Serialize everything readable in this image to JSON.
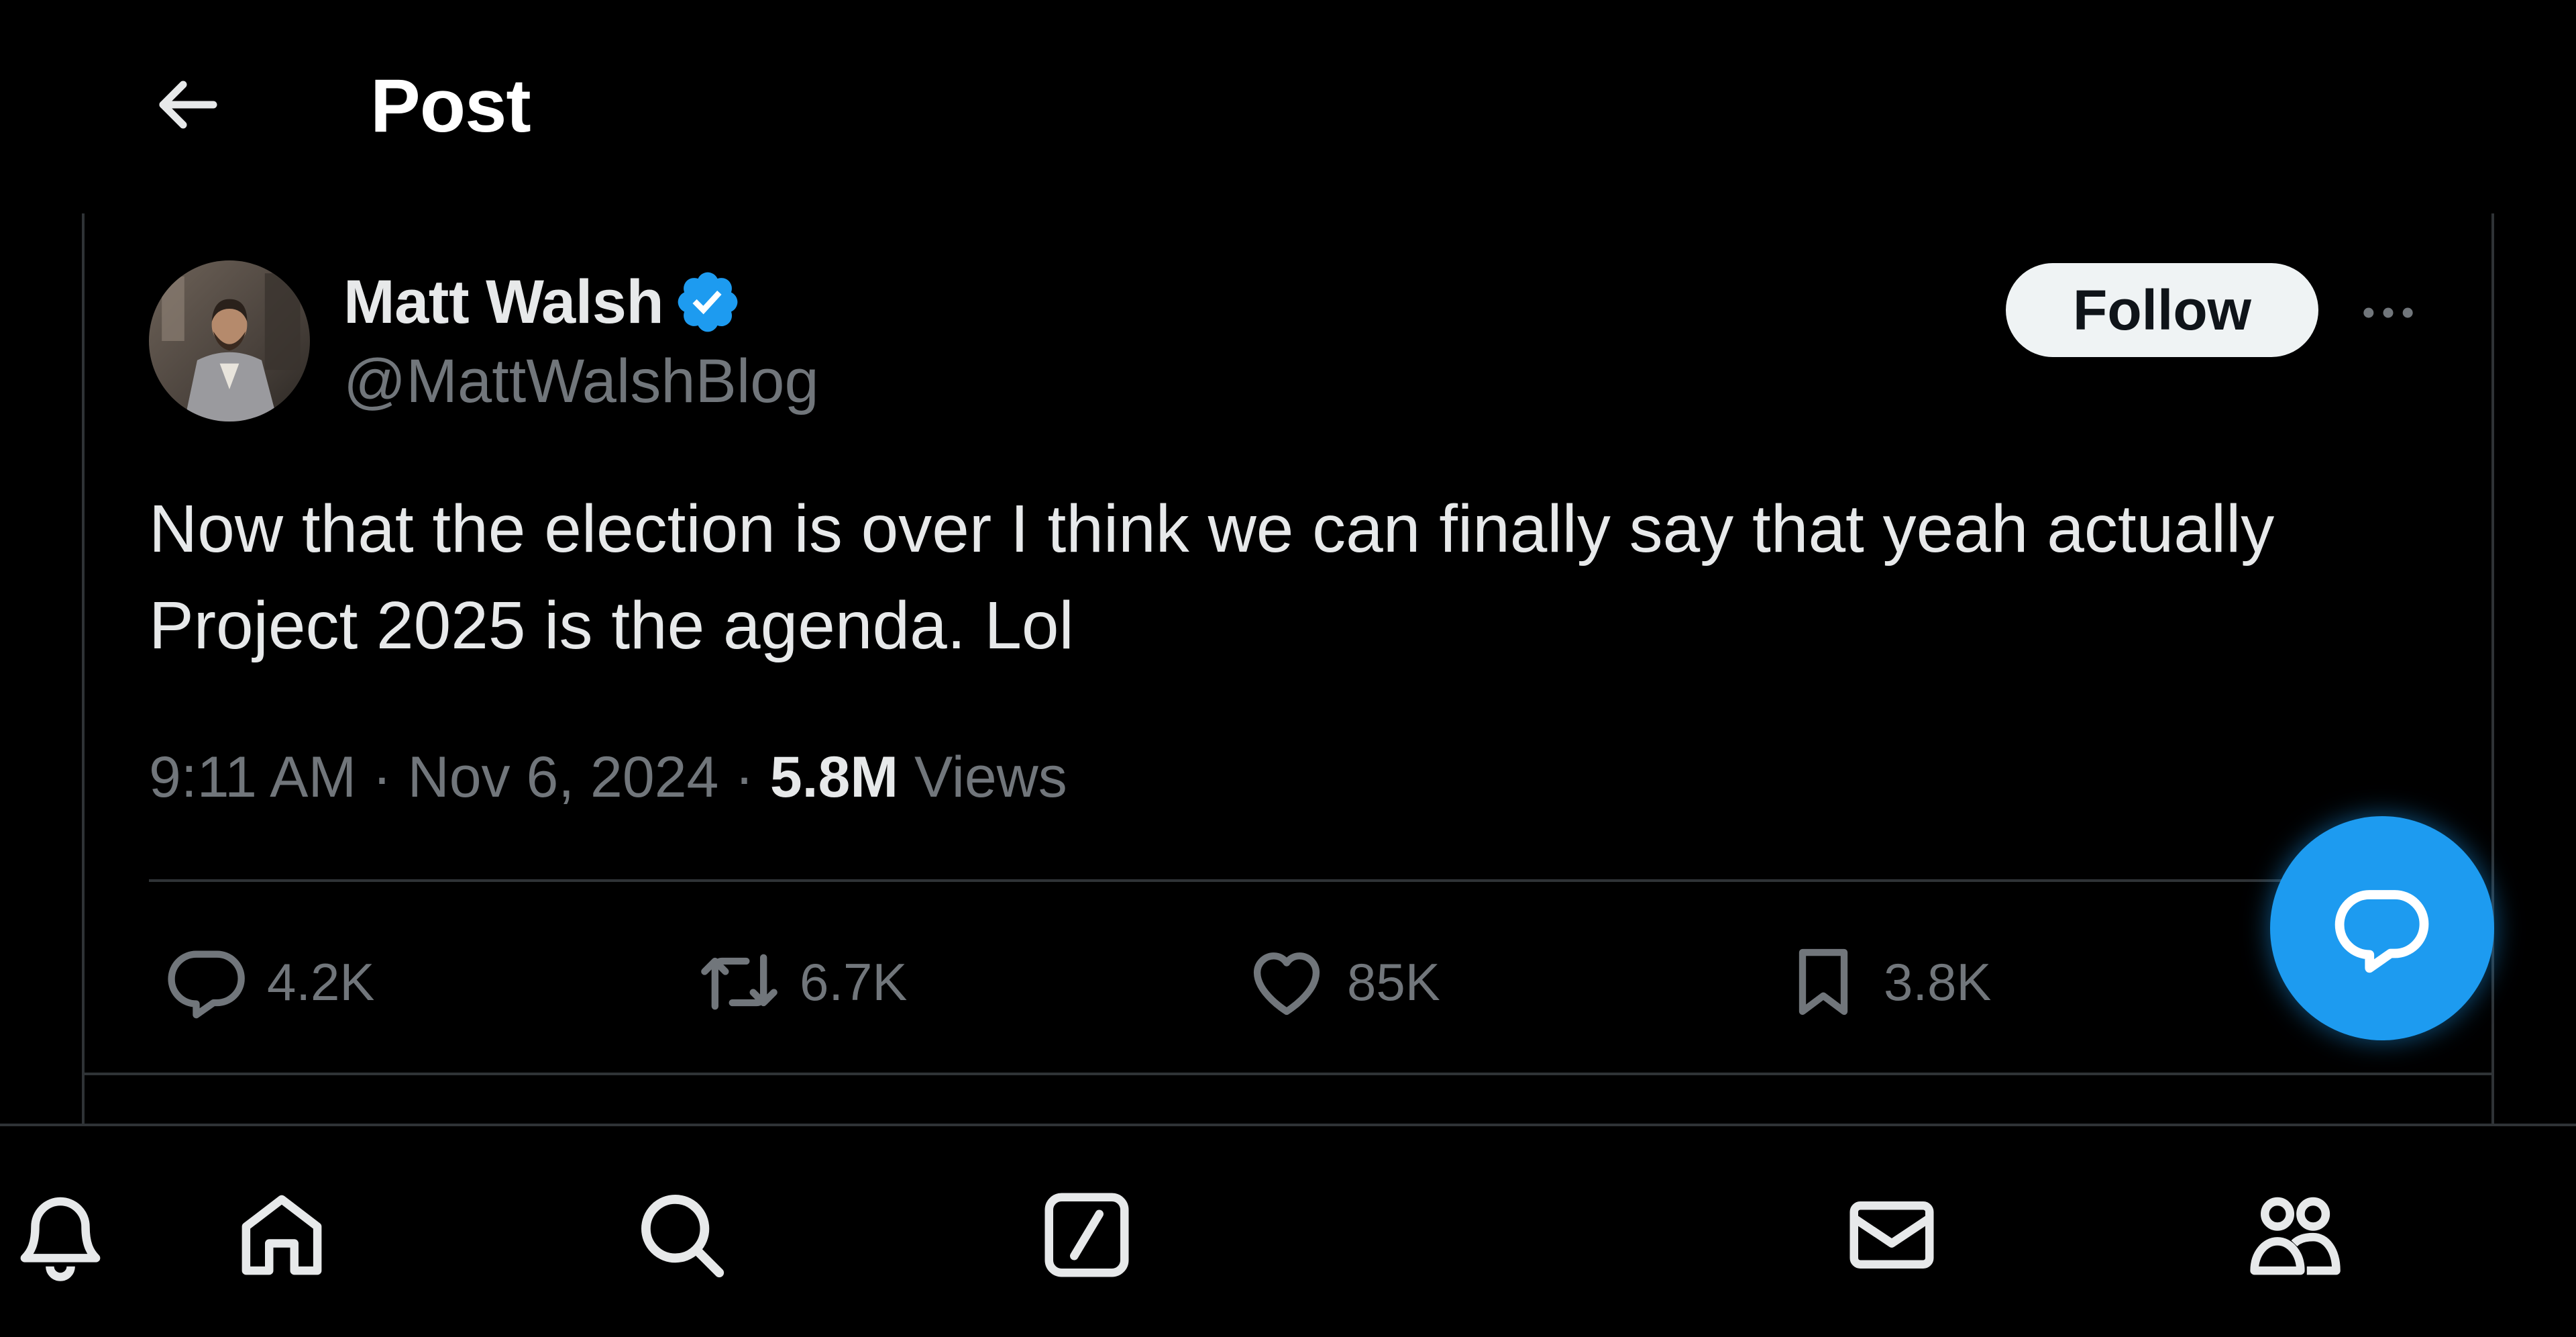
{
  "header": {
    "title": "Post",
    "back_icon": "arrow-left-icon"
  },
  "author": {
    "name": "Matt Walsh",
    "handle": "@MattWalshBlog",
    "verified": true,
    "verified_color": "#1d9bf0",
    "follow_label": "Follow",
    "more_icon": "ellipsis-icon"
  },
  "post": {
    "text": "Now that the election is over I think we can finally say that yeah actually\nProject 2025 is the agenda. Lol",
    "time": "9:11 AM",
    "separator": "·",
    "date": "Nov 6, 2024",
    "views_count": "5.8M",
    "views_label": "Views"
  },
  "actions": {
    "replies": "4.2K",
    "reposts": "6.7K",
    "likes": "85K",
    "bookmarks": "3.8K"
  },
  "fab": {
    "icon": "reply-bubble-icon",
    "color": "#1d9bf0"
  },
  "bottom_nav": {
    "items": [
      "home-icon",
      "search-icon",
      "grok-icon",
      "bell-icon",
      "envelope-icon",
      "communities-icon"
    ]
  },
  "colors": {
    "background": "#000000",
    "primary_text": "#e7e9ea",
    "secondary_text": "#71767b",
    "border": "#2f3336",
    "accent": "#1d9bf0"
  }
}
